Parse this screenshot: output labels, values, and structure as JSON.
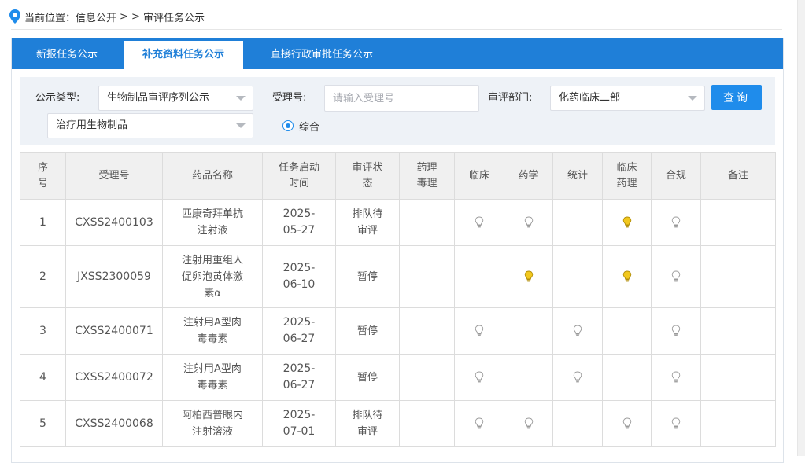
{
  "breadcrumb": {
    "label": "当前位置：",
    "item1": "信息公开",
    "separator": "> >",
    "item2": "审评任务公示"
  },
  "tabs": [
    {
      "label": "新报任务公示",
      "active": false
    },
    {
      "label": "补充资料任务公示",
      "active": true
    },
    {
      "label": "直接行政审批任务公示",
      "active": false
    }
  ],
  "filters": {
    "type_label": "公示类型:",
    "type_value": "生物制品审评序列公示",
    "subtype_value": "治疗用生物制品",
    "accept_label": "受理号:",
    "accept_placeholder": "请输入受理号",
    "dept_label": "审评部门:",
    "dept_value": "化药临床二部",
    "query_label": "查询",
    "radio_label": "综合"
  },
  "table": {
    "headers": [
      "序号",
      "受理号",
      "药品名称",
      "任务启动时间",
      "审评状态",
      "药理毒理",
      "临床",
      "药学",
      "统计",
      "临床药理",
      "合规",
      "备注"
    ],
    "rows": [
      {
        "no": "1",
        "accept": "CXSS2400103",
        "drug": "匹康奇拜单抗注射液",
        "date": "2025-05-27",
        "status": "排队待审评",
        "marks": [
          "",
          "gray",
          "gray",
          "",
          "yellow",
          "gray"
        ],
        "note": ""
      },
      {
        "no": "2",
        "accept": "JXSS2300059",
        "drug": "注射用重组人促卵泡黄体激素α",
        "date": "2025-06-10",
        "status": "暂停",
        "marks": [
          "",
          "",
          "yellow",
          "",
          "yellow",
          "gray"
        ],
        "note": ""
      },
      {
        "no": "3",
        "accept": "CXSS2400071",
        "drug": "注射用A型肉毒毒素",
        "date": "2025-06-27",
        "status": "暂停",
        "marks": [
          "",
          "gray",
          "",
          "gray",
          "",
          "gray"
        ],
        "note": ""
      },
      {
        "no": "4",
        "accept": "CXSS2400072",
        "drug": "注射用A型肉毒毒素",
        "date": "2025-06-27",
        "status": "暂停",
        "marks": [
          "",
          "gray",
          "",
          "gray",
          "",
          "gray"
        ],
        "note": ""
      },
      {
        "no": "5",
        "accept": "CXSS2400068",
        "drug": "阿柏西普眼内注射溶液",
        "date": "2025-07-01",
        "status": "排队待审评",
        "marks": [
          "",
          "gray",
          "gray",
          "",
          "gray",
          "gray"
        ],
        "note": ""
      }
    ]
  },
  "icons": {
    "bulb": "lightbulb-icon",
    "location": "location-pin-icon"
  },
  "colors": {
    "primary": "#1f7fd8",
    "bulb_on": "#f2c81e",
    "bulb_off": "#c8c8c8"
  }
}
